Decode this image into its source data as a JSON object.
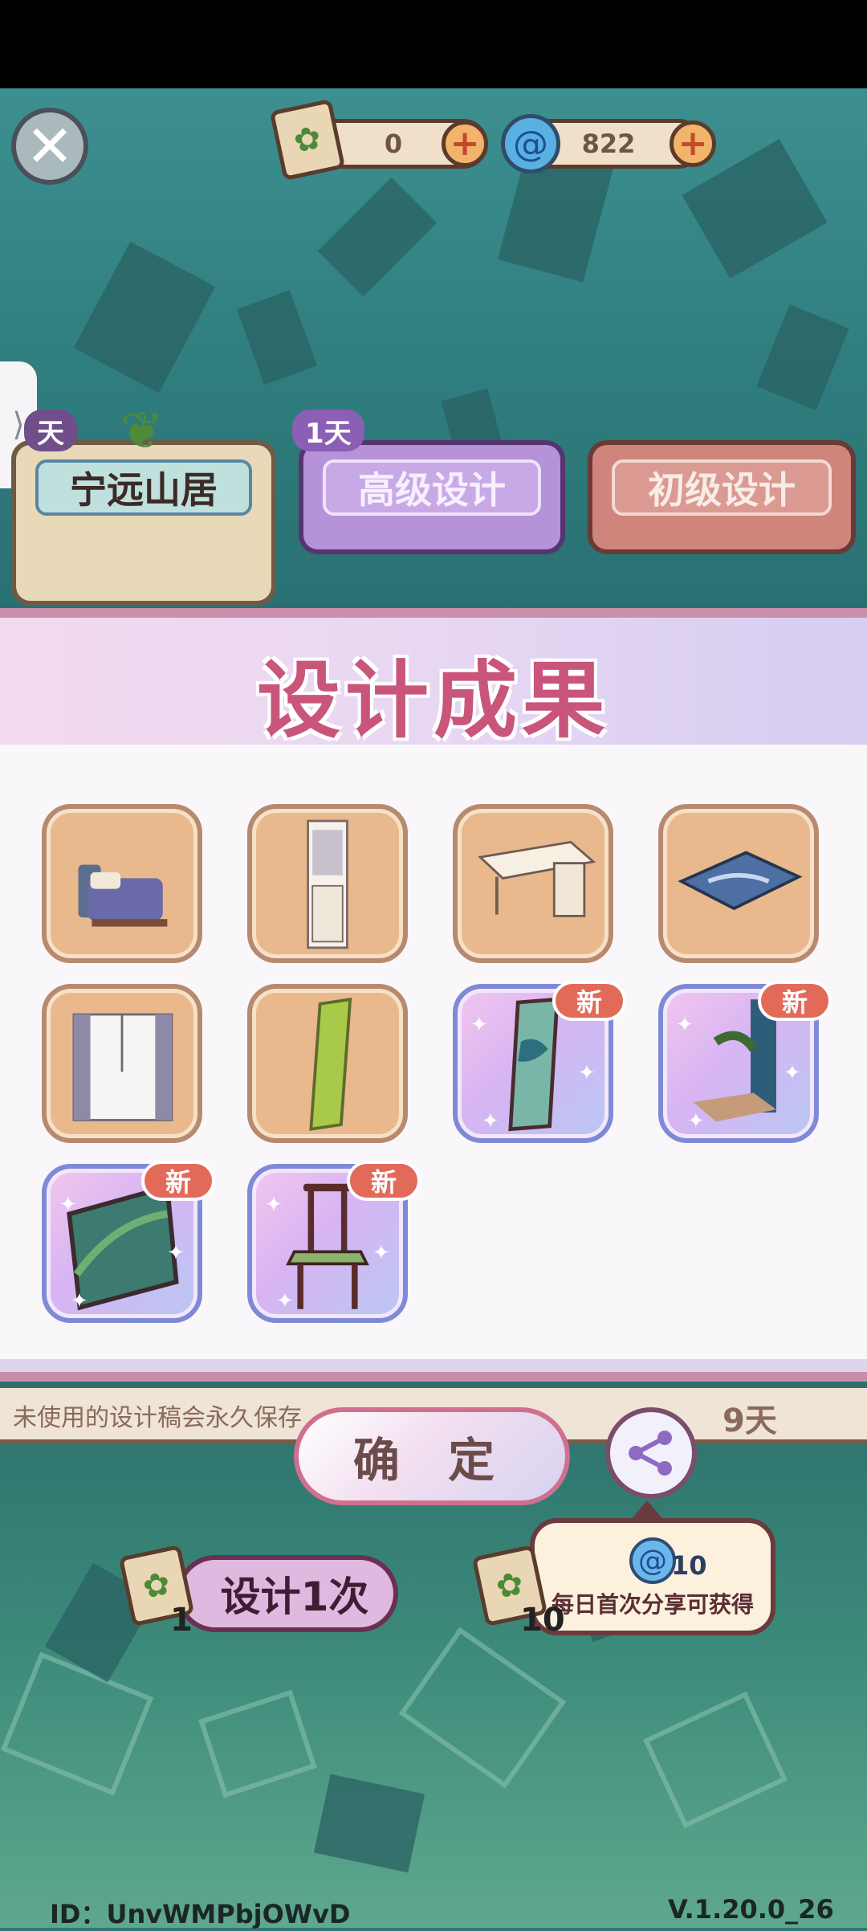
{
  "currency": {
    "scroll_count": "0",
    "swirl_count": "822"
  },
  "side_handle": "⟩",
  "tabs": [
    {
      "day_badge": "天",
      "label": "宁远山居"
    },
    {
      "day_badge": "1天",
      "label": "高级设计"
    },
    {
      "label": "初级设计"
    }
  ],
  "dialog": {
    "title": "设计成果",
    "items": [
      {
        "name": "bed",
        "rarity": "common",
        "new_label": ""
      },
      {
        "name": "cabinet",
        "rarity": "common",
        "new_label": ""
      },
      {
        "name": "desk",
        "rarity": "common",
        "new_label": ""
      },
      {
        "name": "rug",
        "rarity": "common",
        "new_label": ""
      },
      {
        "name": "window-curtain",
        "rarity": "common",
        "new_label": ""
      },
      {
        "name": "green-panel",
        "rarity": "common",
        "new_label": ""
      },
      {
        "name": "landscape-screen",
        "rarity": "rare",
        "new_label": "新"
      },
      {
        "name": "bonsai-screen",
        "rarity": "rare",
        "new_label": "新"
      },
      {
        "name": "garden-window",
        "rarity": "rare",
        "new_label": "新"
      },
      {
        "name": "wooden-chair",
        "rarity": "rare",
        "new_label": "新"
      }
    ]
  },
  "info_text": "未使用的设计稿会永久保存",
  "partial_timer": "9天",
  "confirm_label": "确 定",
  "tooltip": {
    "amount": "10",
    "text": "每日首次分享可获得"
  },
  "design_buttons": [
    {
      "label": "设计1次",
      "count": "1"
    },
    {
      "count": "10"
    }
  ],
  "footer": {
    "id_text": "ID：UnvWMPbjOWvD",
    "version": "V.1.20.0_26"
  },
  "colors": {
    "accent_pink": "#c9567a",
    "common_tile": "#e9b98d",
    "rare_tile_border": "#7f8ad6",
    "new_badge": "#e26a59"
  }
}
